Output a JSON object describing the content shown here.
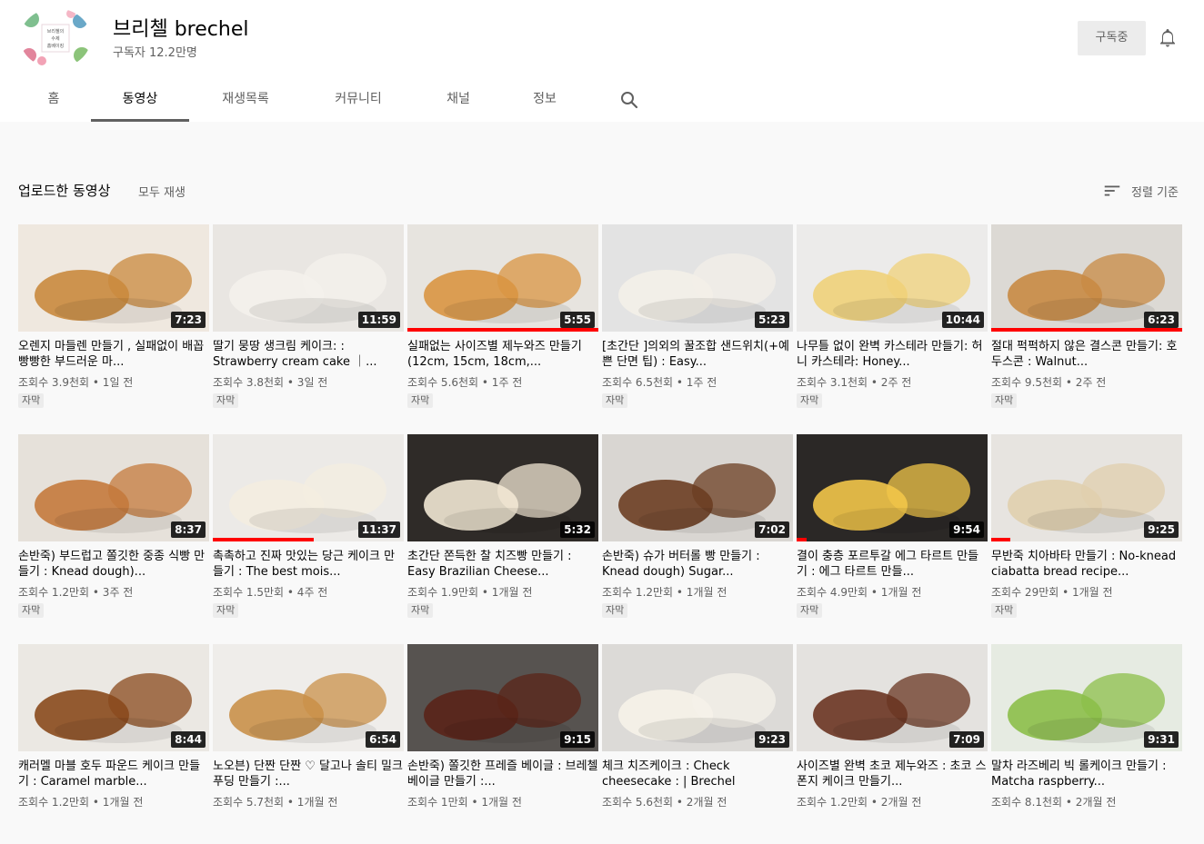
{
  "channel": {
    "name": "브리첼 brechel",
    "subscribers": "구독자 12.2만명",
    "subscribed_label": "구독중",
    "avatar_text": [
      "브리첼의",
      "수제",
      "홈베이킹"
    ]
  },
  "tabs": [
    {
      "label": "홈"
    },
    {
      "label": "동영상"
    },
    {
      "label": "재생목록"
    },
    {
      "label": "커뮤니티"
    },
    {
      "label": "채널"
    },
    {
      "label": "정보"
    }
  ],
  "section": {
    "title": "업로드한 동영상",
    "play_all": "모두 재생",
    "sort_label": "정렬 기준"
  },
  "videos": [
    {
      "title": "오렌지 마들렌 만들기 , 실패없이 배꼽 빵빵한 부드러운 마...",
      "meta": "조회수 3.9천회 • 1일 전",
      "duration": "7:23",
      "badge": "자막",
      "progress": 0,
      "colors": [
        "#efe8df",
        "#c98a3e"
      ]
    },
    {
      "title": "딸기 뭉땅 생크림 케이크: : Strawberry cream cake ｜...",
      "meta": "조회수 3.8천회 • 3일 전",
      "duration": "11:59",
      "badge": "자막",
      "progress": 0,
      "colors": [
        "#e9e6e2",
        "#f4f1ec"
      ]
    },
    {
      "title": "실패없는 사이즈별 제누와즈 만들기 (12cm, 15cm, 18cm,...",
      "meta": "조회수 5.6천회 • 1주 전",
      "duration": "5:55",
      "badge": "자막",
      "progress": 1.0,
      "colors": [
        "#e7e4df",
        "#d99543"
      ]
    },
    {
      "title": "[초간단 ]의외의 꿀조합 샌드위치(+예쁜 단면 팁) : Easy...",
      "meta": "조회수 6.5천회 • 1주 전",
      "duration": "5:23",
      "badge": "자막",
      "progress": 0,
      "colors": [
        "#e3e3e3",
        "#f3efe8"
      ]
    },
    {
      "title": "나무틀 없이 완벽 카스테라 만들기: 허니 카스테라: Honey...",
      "meta": "조회수 3.1천회 • 2주 전",
      "duration": "10:44",
      "badge": "자막",
      "progress": 0,
      "colors": [
        "#ecebea",
        "#f0d27a"
      ]
    },
    {
      "title": "절대 퍽퍽하지 않은 결스콘 만들기: 호두스콘 : Walnut...",
      "meta": "조회수 9.5천회 • 2주 전",
      "duration": "6:23",
      "badge": "자막",
      "progress": 1.0,
      "colors": [
        "#dcd9d4",
        "#c88a44"
      ]
    },
    {
      "title": "손반죽) 부드럽고 쫄깃한 중종 식빵 만들기 : Knead dough)...",
      "meta": "조회수 1.2만회 • 3주 전",
      "duration": "8:37",
      "badge": "자막",
      "progress": 0,
      "colors": [
        "#e6e1da",
        "#c47a3c"
      ]
    },
    {
      "title": "촉촉하고 진짜 맛있는 당근 케이크 만들기 : The best mois...",
      "meta": "조회수 1.5만회 • 4주 전",
      "duration": "11:37",
      "badge": "자막",
      "progress": 0.53,
      "colors": [
        "#eceae7",
        "#f4ede0"
      ]
    },
    {
      "title": "초간단 쫀득한 찰 치즈빵 만들기 : Easy Brazilian Cheese...",
      "meta": "조회수 1.9만회 • 1개월 전",
      "duration": "5:32",
      "badge": "자막",
      "progress": 0,
      "colors": [
        "#2f2b28",
        "#f1e7d3"
      ]
    },
    {
      "title": "손반죽) 슈가 버터롤 빵 만들기 : Knead dough) Sugar...",
      "meta": "조회수 1.2만회 • 1개월 전",
      "duration": "7:02",
      "badge": "자막",
      "progress": 0,
      "colors": [
        "#d9d6d2",
        "#6b3e22"
      ]
    },
    {
      "title": "결이 충층 포르투갈 에그 타르트 만들기 : 에그 타르트 만들...",
      "meta": "조회수 4.9만회 • 1개월 전",
      "duration": "9:54",
      "badge": "자막",
      "progress": 0.05,
      "colors": [
        "#2b2826",
        "#f2c54a"
      ]
    },
    {
      "title": "무반죽 치아바타 만들기 : No-knead ciabatta bread recipe...",
      "meta": "조회수 29만회 • 1개월 전",
      "duration": "9:25",
      "badge": "자막",
      "progress": 0.1,
      "colors": [
        "#e7e4e0",
        "#e0cfae"
      ]
    },
    {
      "title": "캐러멜 마블 호두 파운드 케이크 만들기 : Caramel marble...",
      "meta": "조회수 1.2만회 • 1개월 전",
      "duration": "8:44",
      "badge": "",
      "progress": 0,
      "colors": [
        "#ebe8e3",
        "#8a4a1c"
      ]
    },
    {
      "title": "노오븐) 단짠 단짠 ♡ 달고나 솔티 밀크 푸딩 만들기 :...",
      "meta": "조회수 5.7천회 • 1개월 전",
      "duration": "6:54",
      "badge": "",
      "progress": 0,
      "colors": [
        "#efedea",
        "#c9904a"
      ]
    },
    {
      "title": "손반죽) 쫄깃한 프레즐 베이글 : 브레첼 베이글 만들기 :...",
      "meta": "조회수 1만회 • 1개월 전",
      "duration": "9:15",
      "badge": "",
      "progress": 0,
      "colors": [
        "#575350",
        "#5a2418"
      ]
    },
    {
      "title": "체크 치즈케이크 : Check cheesecake : | Brechel",
      "meta": "조회수 5.6천회 • 2개월 전",
      "duration": "9:23",
      "badge": "",
      "progress": 0,
      "colors": [
        "#dcdad7",
        "#f6f2e9"
      ]
    },
    {
      "title": "사이즈별 완벽 초코 제누와즈 : 초코 스폰지 케이크 만들기...",
      "meta": "조회수 1.2만회 • 2개월 전",
      "duration": "7:09",
      "badge": "",
      "progress": 0,
      "colors": [
        "#e4e2df",
        "#6a3522"
      ]
    },
    {
      "title": "말차 라즈베리 빅 롤케이크 만들기 : Matcha raspberry...",
      "meta": "조회수 8.1천회 • 2개월 전",
      "duration": "9:31",
      "badge": "",
      "progress": 0,
      "colors": [
        "#e6ebe2",
        "#8cbf4a"
      ]
    }
  ]
}
